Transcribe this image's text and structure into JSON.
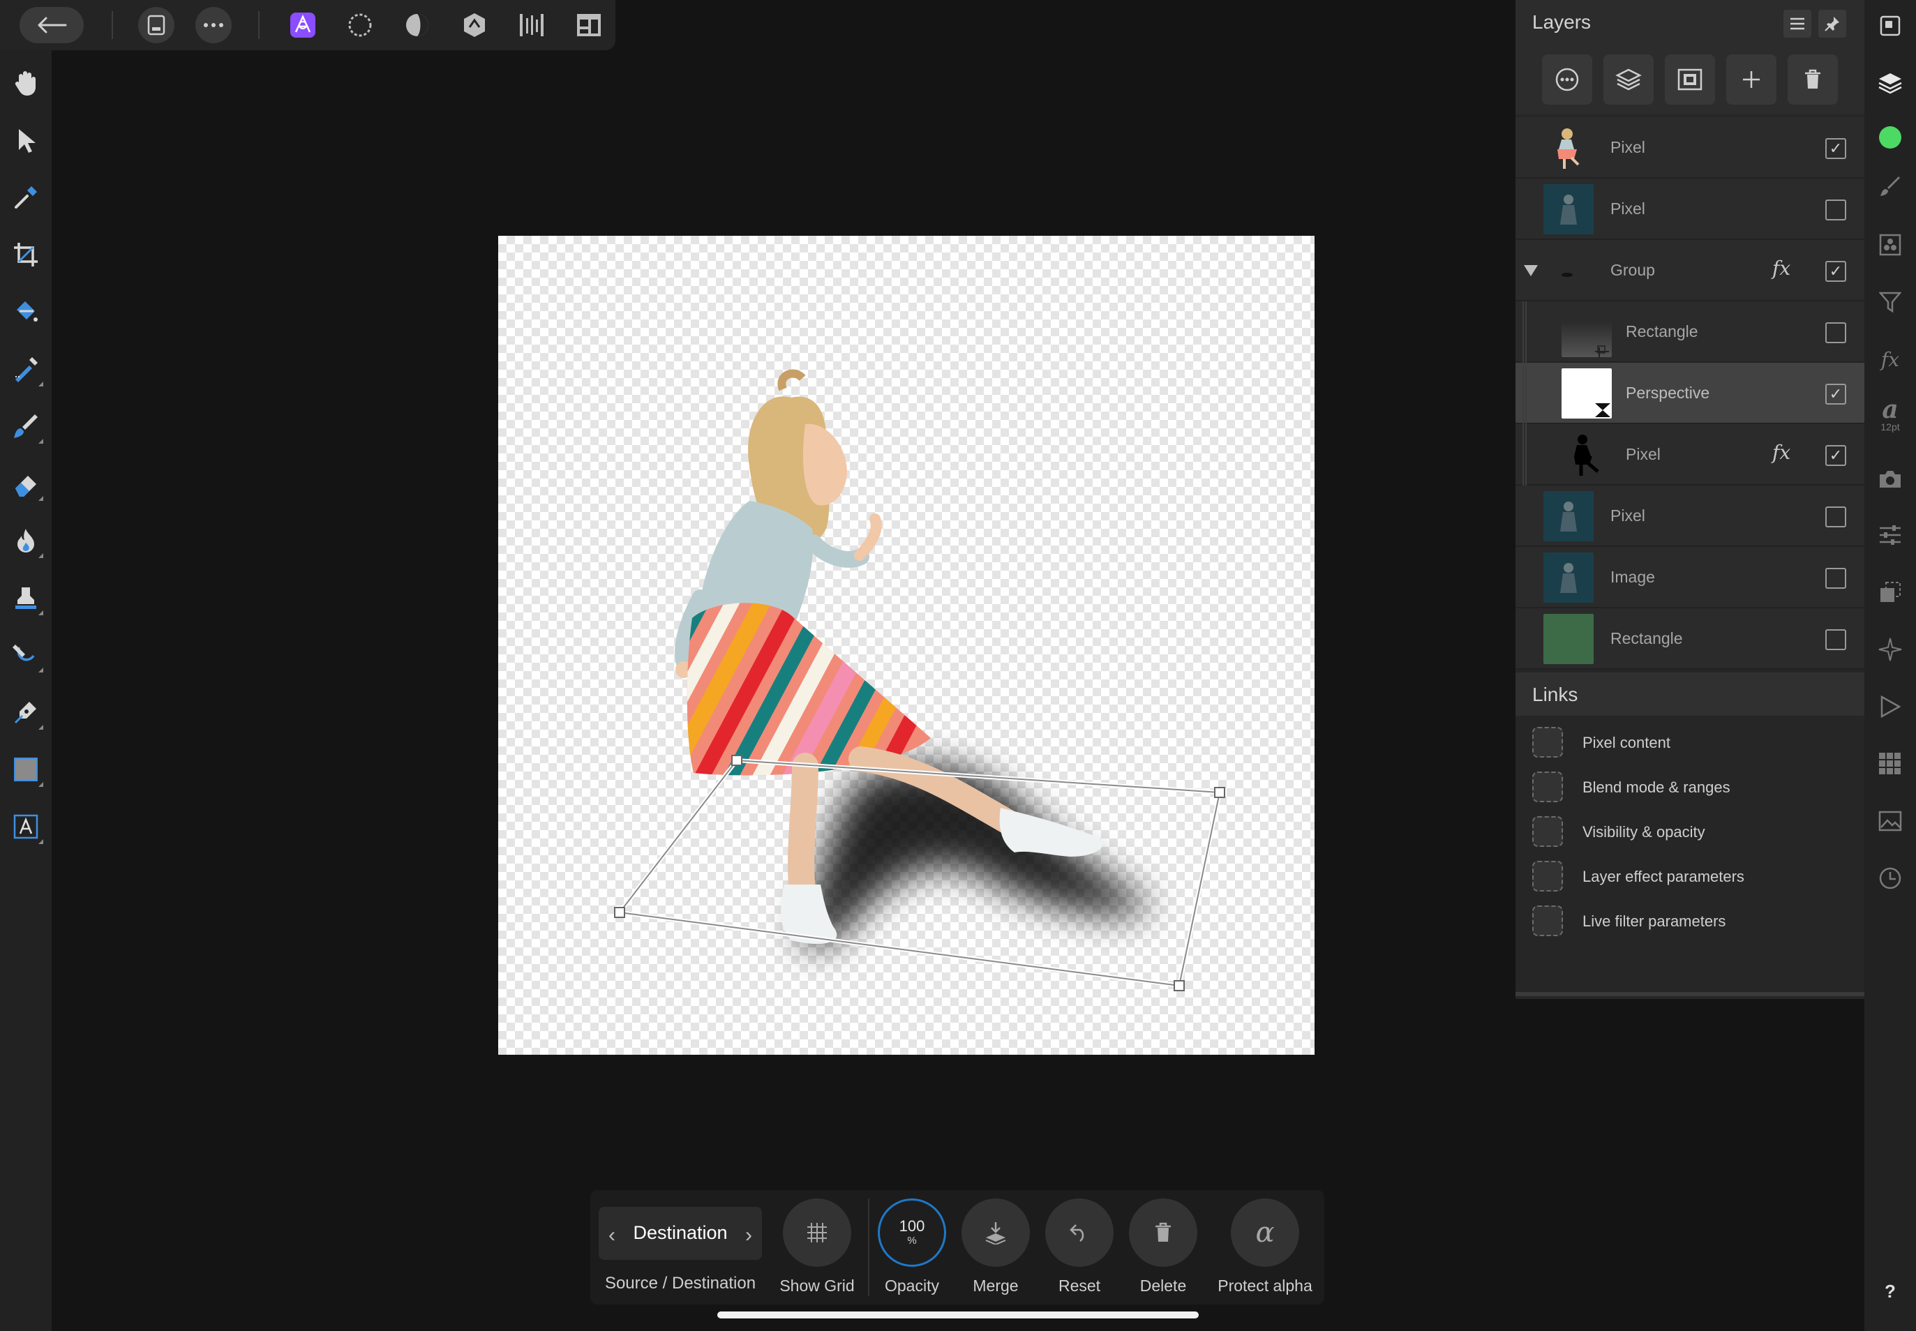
{
  "layers": {
    "title": "Layers",
    "items": [
      {
        "name": "Pixel",
        "checked": true
      },
      {
        "name": "Pixel",
        "checked": false
      },
      {
        "name": "Group",
        "checked": true
      },
      {
        "name": "Rectangle",
        "checked": false
      },
      {
        "name": "Perspective",
        "checked": true
      },
      {
        "name": "Pixel",
        "checked": true
      },
      {
        "name": "Pixel",
        "checked": false
      },
      {
        "name": "Image",
        "checked": false
      },
      {
        "name": "Rectangle",
        "checked": false
      }
    ],
    "fx_label": "fx",
    "check_mark": "✓"
  },
  "links": {
    "title": "Links",
    "items": [
      "Pixel content",
      "Blend mode & ranges",
      "Visibility & opacity",
      "Layer effect parameters",
      "Live filter parameters"
    ]
  },
  "context_toolbar": {
    "selector_value": "Destination",
    "selector_caption": "Source / Destination",
    "show_grid": "Show Grid",
    "opacity_value": "100",
    "opacity_unit": "%",
    "opacity_label": "Opacity",
    "merge": "Merge",
    "reset": "Reset",
    "delete": "Delete",
    "protect_alpha": "Protect alpha",
    "alpha_glyph": "α"
  },
  "right_strip": {
    "text_style_glyph": "a",
    "text_style_size": "12pt",
    "fx_glyph": "fx"
  },
  "help": "?",
  "colors": {
    "accent_blue": "#1f78c8",
    "persona_purple": "#8b4dff",
    "color_dot": "#4cd964",
    "panel_bg": "#262626",
    "canvas_bg": "#141414"
  }
}
